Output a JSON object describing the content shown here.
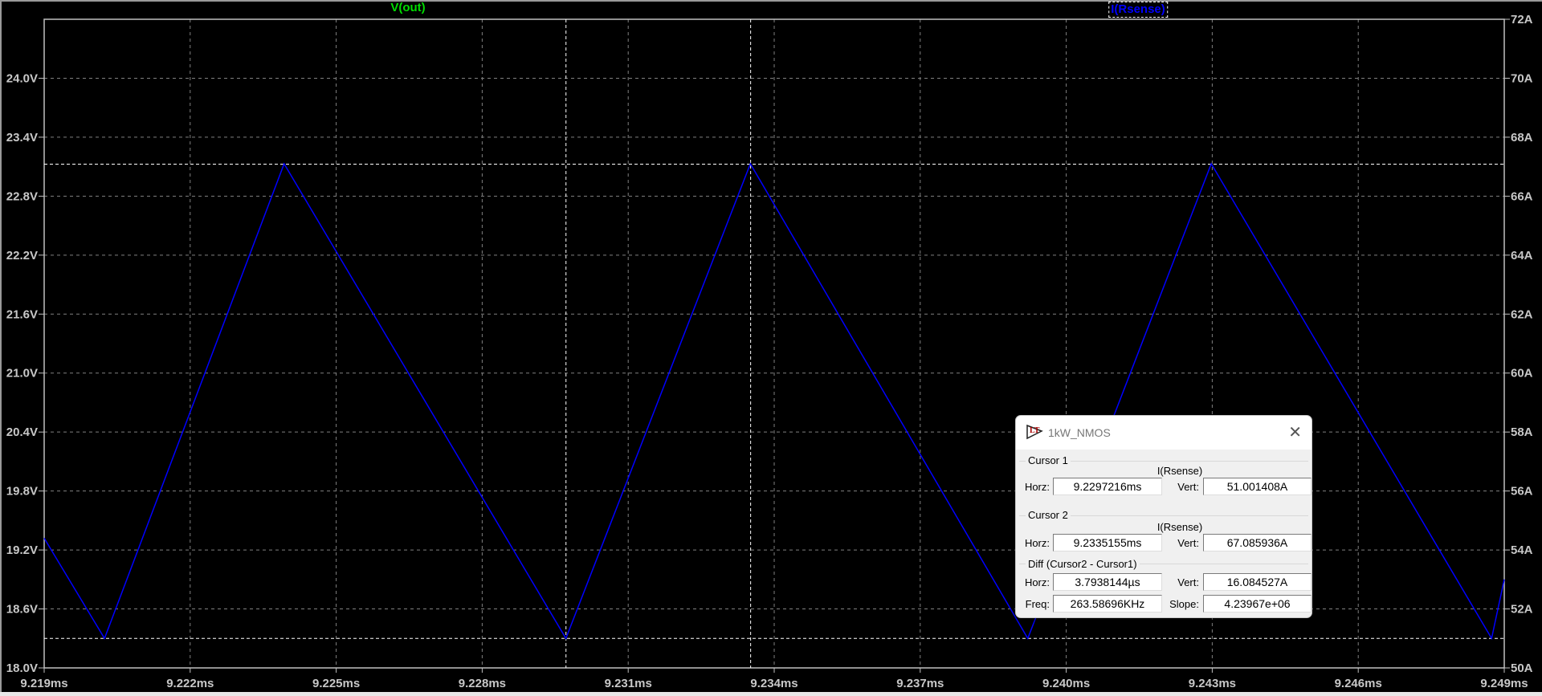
{
  "traces": {
    "left": {
      "label": "V(out)",
      "color": "#00dd00"
    },
    "right": {
      "label": "I(Rsense)",
      "color": "#0000ff",
      "selected": true
    }
  },
  "chart_data": {
    "type": "line",
    "x_ticks": [
      "9.219ms",
      "9.222ms",
      "9.225ms",
      "9.228ms",
      "9.231ms",
      "9.234ms",
      "9.237ms",
      "9.240ms",
      "9.243ms",
      "9.246ms",
      "9.249ms"
    ],
    "left_ticks": [
      "18.0V",
      "18.6V",
      "19.2V",
      "19.8V",
      "20.4V",
      "21.0V",
      "21.6V",
      "22.2V",
      "22.8V",
      "23.4V",
      "24.0V"
    ],
    "right_ticks": [
      "50A",
      "52A",
      "54A",
      "56A",
      "58A",
      "60A",
      "62A",
      "64A",
      "66A",
      "68A",
      "70A",
      "72A"
    ],
    "xlim_ms": [
      9.219,
      9.249
    ],
    "ylim_left_V": [
      18.0,
      24.6
    ],
    "ylim_right_A": [
      50,
      72
    ],
    "grid": true,
    "series": [
      {
        "name": "I(Rsense)",
        "axis": "right",
        "color": "#0000ff",
        "x_ms": [
          9.219,
          9.22024,
          9.22393,
          9.22972,
          9.23351,
          9.23921,
          9.24298,
          9.24874,
          9.249
        ],
        "y_A": [
          54.4,
          51.0,
          67.1,
          51.0,
          67.1,
          51.0,
          67.1,
          51.0,
          53.0
        ]
      }
    ],
    "cursors": {
      "cursor1": {
        "x_ms": 9.2297216,
        "y_A": 51.001408
      },
      "cursor2": {
        "x_ms": 9.2335155,
        "y_A": 67.085936
      }
    }
  },
  "dialog": {
    "title": "1kW_NMOS",
    "close_icon": "close-icon",
    "cursor1": {
      "label": "Cursor 1",
      "signal": "I(Rsense)",
      "horz_label": "Horz:",
      "horz": "9.2297216ms",
      "vert_label": "Vert:",
      "vert": "51.001408A"
    },
    "cursor2": {
      "label": "Cursor 2",
      "signal": "I(Rsense)",
      "horz_label": "Horz:",
      "horz": "9.2335155ms",
      "vert_label": "Vert:",
      "vert": "67.085936A"
    },
    "diff": {
      "label": "Diff (Cursor2 - Cursor1)",
      "horz_label": "Horz:",
      "horz": "3.7938144µs",
      "vert_label": "Vert:",
      "vert": "16.084527A",
      "freq_label": "Freq:",
      "freq": "263.58696KHz",
      "slope_label": "Slope:",
      "slope": "4.23967e+06"
    }
  }
}
